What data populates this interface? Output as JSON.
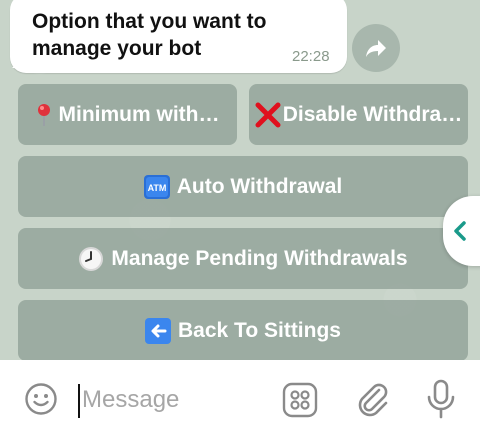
{
  "message": {
    "text": "Option that  you want to\nmanage your bot",
    "time": "22:28"
  },
  "keyboard": {
    "row1": [
      {
        "label": "Minimum with…",
        "icon": "pin-icon"
      },
      {
        "label": "Disable Withdra…",
        "icon": "red-cross-icon"
      }
    ],
    "auto": {
      "label": "Auto Withdrawal",
      "icon": "atm-icon"
    },
    "pending": {
      "label": "Manage Pending Withdrawals",
      "icon": "clock-icon"
    },
    "back": {
      "label": "Back To Sittings",
      "icon": "left-arrow-icon"
    }
  },
  "input": {
    "placeholder": "Message"
  },
  "atm_badge": "ATM",
  "colors": {
    "accent": "#1a9a8a",
    "button_bg": "#7a8a84",
    "bubble": "#ffffff"
  }
}
